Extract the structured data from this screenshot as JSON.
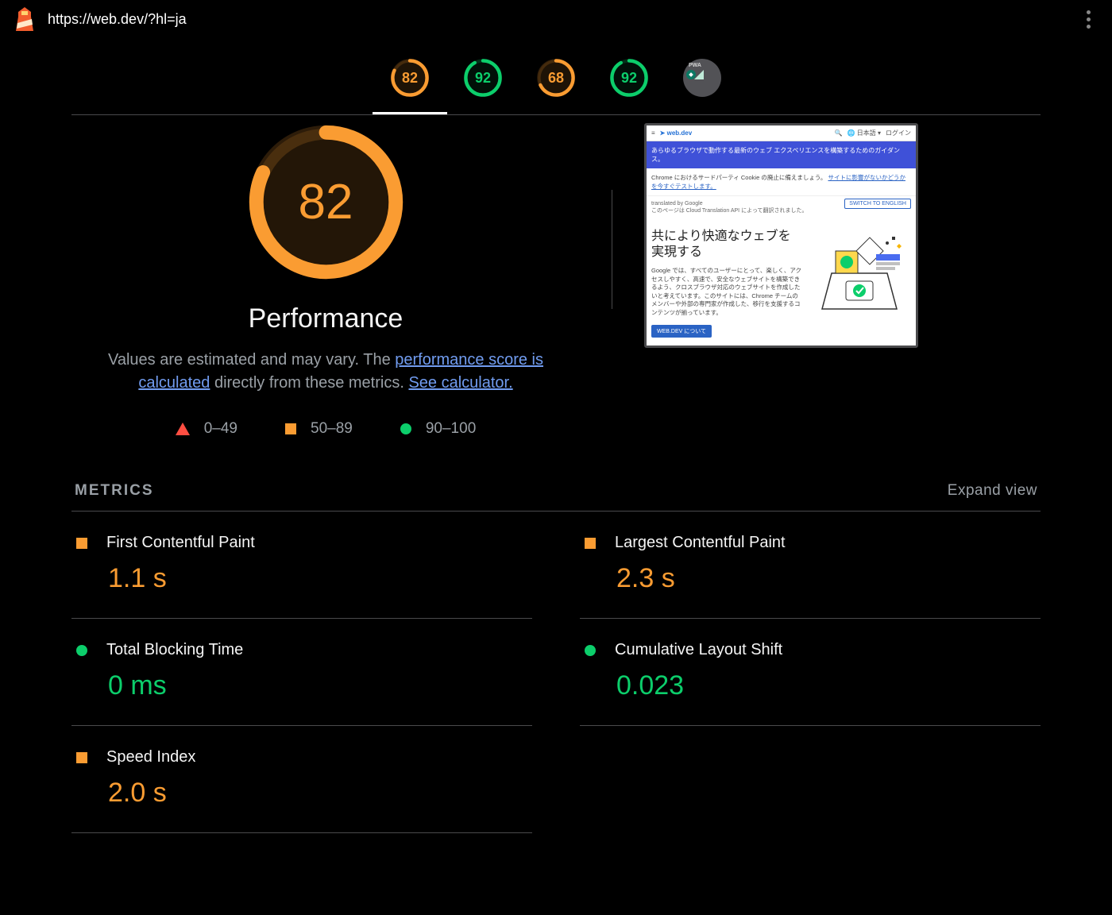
{
  "topbar": {
    "url": "https://web.dev/?hl=ja"
  },
  "categories": [
    {
      "id": "performance",
      "score": 82,
      "band": "orange",
      "active": true
    },
    {
      "id": "accessibility",
      "score": 92,
      "band": "green",
      "active": false
    },
    {
      "id": "best-practices",
      "score": 68,
      "band": "orange",
      "active": false
    },
    {
      "id": "seo",
      "score": 92,
      "band": "green",
      "active": false
    },
    {
      "id": "pwa",
      "score": null,
      "band": "grey",
      "active": false
    }
  ],
  "performance": {
    "score": 82,
    "title": "Performance",
    "explain_before": "Values are estimated and may vary. The ",
    "link1": "performance score is calculated",
    "explain_mid": " directly from these metrics. ",
    "link2": "See calculator."
  },
  "legend": {
    "fail": "0–49",
    "avg": "50–89",
    "pass": "90–100"
  },
  "thumbnail": {
    "site": "web.dev",
    "search_icon": "Q",
    "lang": "日本語 ▾",
    "login": "ログイン",
    "banner": "あらゆるブラウザで動作する最新のウェブ エクスペリエンスを構築するためのガイダンス。",
    "notice_before": "Chrome におけるサードパーティ Cookie の廃止に備えましょう。",
    "notice_link": "サイトに影響がないかどうかを今すぐテストします。",
    "translated_by": "translated by Google",
    "translated_note": "このページは Cloud Translation API によって翻訳されました。",
    "switch_btn": "SWITCH TO ENGLISH",
    "headline": "共により快適なウェブを実現する",
    "paragraph": "Google では、すべてのユーザーにとって、楽しく、アクセスしやすく、高速で、安全なウェブサイトを構築できるよう、クロスブラウザ対応のウェブサイトを作成したいと考えています。このサイトには、Chrome チームのメンバーや外部の専門家が作成した、移行を支援するコンテンツが揃っています。",
    "cta": "WEB.DEV について"
  },
  "metrics_section": {
    "title": "METRICS",
    "expand": "Expand view"
  },
  "metrics": [
    {
      "name": "First Contentful Paint",
      "value": "1.1 s",
      "band": "orange",
      "col": 0
    },
    {
      "name": "Largest Contentful Paint",
      "value": "2.3 s",
      "band": "orange",
      "col": 1
    },
    {
      "name": "Total Blocking Time",
      "value": "0 ms",
      "band": "green",
      "col": 0
    },
    {
      "name": "Cumulative Layout Shift",
      "value": "0.023",
      "band": "green",
      "col": 1
    },
    {
      "name": "Speed Index",
      "value": "2.0 s",
      "band": "orange",
      "col": 0
    }
  ],
  "colors": {
    "orange": "#fa9c32",
    "green": "#0cce6b",
    "red": "#ff4e42"
  }
}
